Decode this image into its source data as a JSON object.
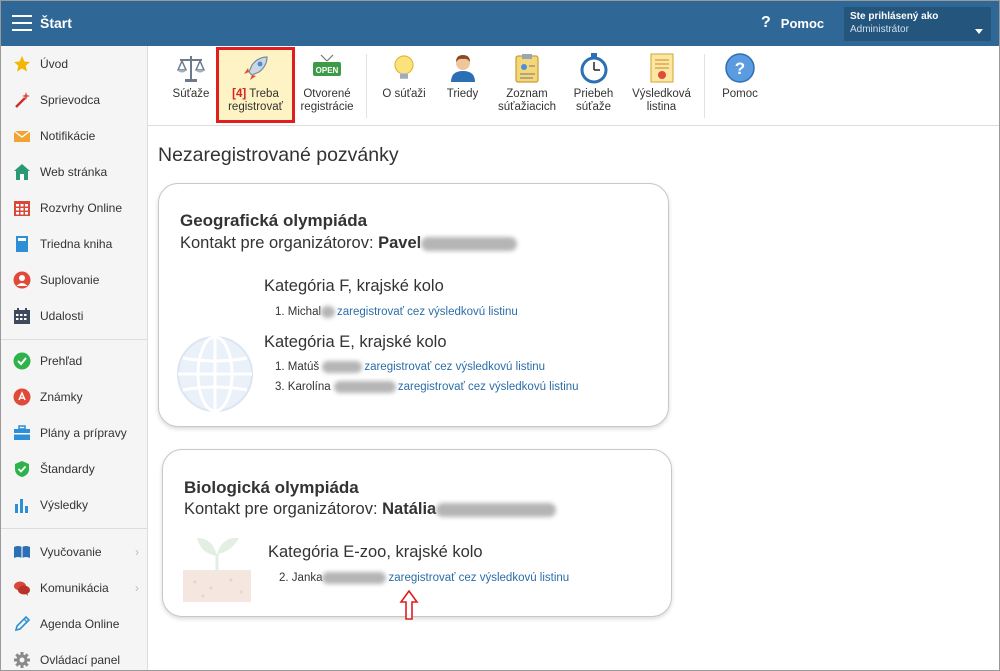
{
  "topbar": {
    "title": "Štart",
    "help_label": "Pomoc",
    "user_label": "Ste prihlásený ako",
    "user_role": "Administrátor"
  },
  "sidebar": {
    "items": [
      {
        "label": "Úvod",
        "icon": "star-icon"
      },
      {
        "label": "Sprievodca",
        "icon": "magic-wand-icon"
      },
      {
        "label": "Notifikácie",
        "icon": "envelope-icon"
      },
      {
        "label": "Web stránka",
        "icon": "house-icon"
      },
      {
        "label": "Rozvrhy Online",
        "icon": "timetable-icon"
      },
      {
        "label": "Triedna kniha",
        "icon": "book-icon"
      },
      {
        "label": "Suplovanie",
        "icon": "person-icon"
      },
      {
        "label": "Udalosti",
        "icon": "calendar-icon"
      },
      {
        "label": "Prehľad",
        "icon": "check-circle-icon"
      },
      {
        "label": "Známky",
        "icon": "grade-icon"
      },
      {
        "label": "Plány a prípravy",
        "icon": "briefcase-icon"
      },
      {
        "label": "Štandardy",
        "icon": "shield-check-icon"
      },
      {
        "label": "Výsledky",
        "icon": "bar-chart-icon"
      },
      {
        "label": "Vyučovanie",
        "icon": "open-book-icon",
        "arrow": "›"
      },
      {
        "label": "Komunikácia",
        "icon": "chat-bubbles-icon",
        "arrow": "›"
      },
      {
        "label": "Agenda Online",
        "icon": "pen-icon"
      },
      {
        "label": "Ovládací panel",
        "icon": "gear-icon"
      }
    ]
  },
  "toolbar": {
    "items": [
      {
        "label1": "Súťaže",
        "label2": "",
        "icon": "scales-icon"
      },
      {
        "count": "[4]",
        "label1": "Treba",
        "label2": "registrovať",
        "icon": "rocket-icon"
      },
      {
        "label1": "Otvorené",
        "label2": "registrácie",
        "icon": "open-sign-icon",
        "sign_text": "OPEN"
      },
      {
        "label1": "O súťaži",
        "label2": "",
        "icon": "lightbulb-icon"
      },
      {
        "label1": "Triedy",
        "label2": "",
        "icon": "student-icon"
      },
      {
        "label1": "Zoznam",
        "label2": "súťažiacich",
        "icon": "clipboard-icon"
      },
      {
        "label1": "Priebeh",
        "label2": "súťaže",
        "icon": "stopwatch-icon"
      },
      {
        "label1": "Výsledková",
        "label2": "listina",
        "icon": "certificate-icon"
      },
      {
        "label1": "Pomoc",
        "label2": "",
        "icon": "help-circle-icon"
      }
    ]
  },
  "main": {
    "title": "Nezaregistrované pozvánky",
    "cards": [
      {
        "title": "Geografická olympiáda",
        "contact_label": "Kontakt pre organizátorov:",
        "contact_name": "Pavel",
        "categories": [
          {
            "title": "Kategória F, krajské kolo",
            "rows": [
              {
                "num": "1.",
                "name": "Michal",
                "link": "zaregistrovať cez výsledkovú listinu"
              }
            ]
          },
          {
            "title": "Kategória E, krajské kolo",
            "rows": [
              {
                "num": "1.",
                "name": "Matúš",
                "link": "zaregistrovať cez výsledkovú listinu"
              },
              {
                "num": "3.",
                "name": "Karolína",
                "link": "zaregistrovať cez výsledkovú listinu"
              }
            ]
          }
        ]
      },
      {
        "title": "Biologická olympiáda",
        "contact_label": "Kontakt pre organizátorov:",
        "contact_name": "Natália",
        "categories": [
          {
            "title": "Kategória E-zoo, krajské kolo",
            "rows": [
              {
                "num": "2.",
                "name": "Janka",
                "link": "zaregistrovať cez výsledkovú listinu"
              }
            ]
          }
        ]
      }
    ]
  },
  "colors": {
    "topbar": "#2f6796",
    "link": "#2b6da8",
    "highlight_border": "#e01e1e",
    "highlight_bg": "#fdf3c4"
  }
}
